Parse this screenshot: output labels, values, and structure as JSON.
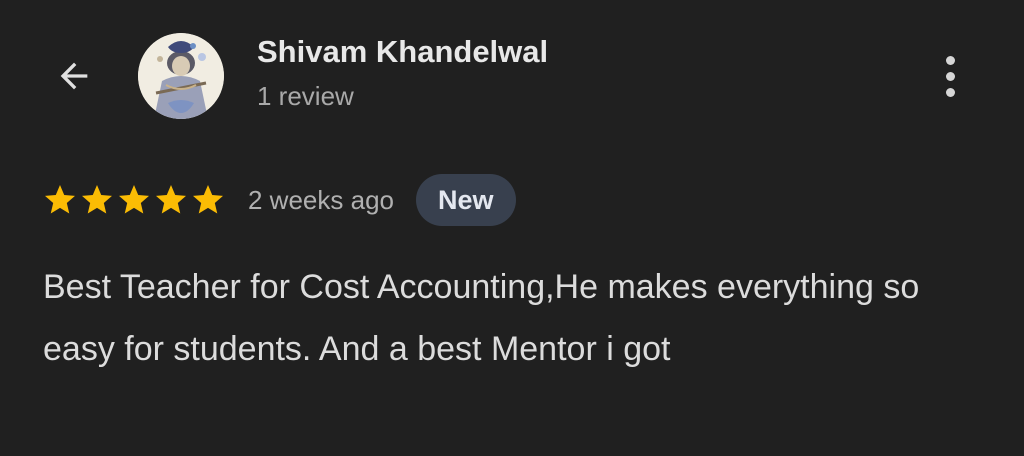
{
  "header": {
    "back_icon": "arrow-left-icon",
    "author_name": "Shivam Khandelwal",
    "review_count": "1 review",
    "more_icon": "more-vert-icon"
  },
  "review": {
    "rating": 5,
    "max_rating": 5,
    "star_color": "#fbbc04",
    "time_ago": "2 weeks ago",
    "badge_label": "New",
    "text": "Best Teacher for Cost Accounting,He makes everything so easy for students. And a best Mentor i got"
  }
}
